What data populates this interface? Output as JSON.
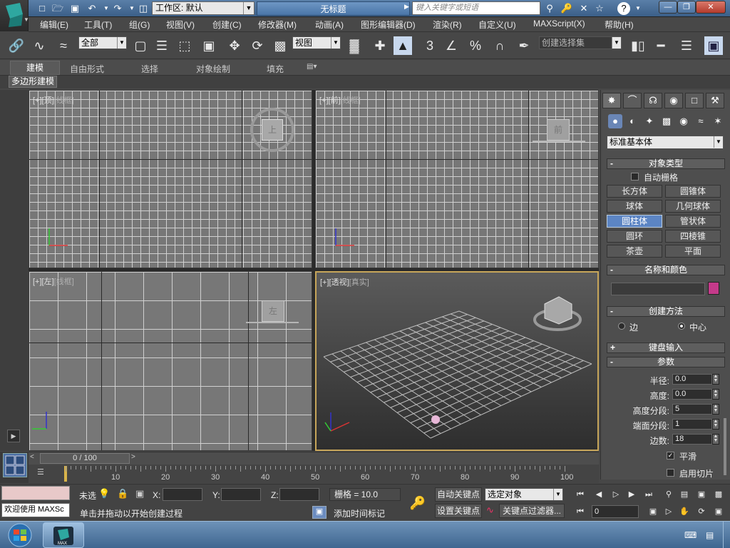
{
  "title_bar": {
    "workspace_label": "工作区: 默认",
    "document_title": "无标题",
    "search_placeholder": "键入关键字或短语"
  },
  "menu": [
    "编辑(E)",
    "工具(T)",
    "组(G)",
    "视图(V)",
    "创建(C)",
    "修改器(M)",
    "动画(A)",
    "图形编辑器(D)",
    "渲染(R)",
    "自定义(U)",
    "MAXScript(X)",
    "帮助(H)"
  ],
  "toolbar": {
    "filter_value": "全部",
    "coord_value": "视图",
    "snap_count": "3",
    "selection_set_placeholder": "创建选择集"
  },
  "ribbon": {
    "tabs": [
      "建模",
      "自由形式",
      "选择",
      "对象绘制",
      "填充"
    ],
    "sub_label": "多边形建模"
  },
  "viewports": {
    "top": {
      "plus": "[+]",
      "name": "[顶]",
      "mode": "[线框]",
      "cube_label": "上"
    },
    "front": {
      "plus": "[+]",
      "name": "[前]",
      "mode": "[线框]",
      "cube_label": "前"
    },
    "left": {
      "plus": "[+]",
      "name": "[左]",
      "mode": "[线框]",
      "cube_label": "左"
    },
    "persp": {
      "plus": "[+]",
      "name": "[透视]",
      "mode": "[真实]"
    }
  },
  "command_panel": {
    "category": "标准基本体",
    "object_type_title": "对象类型",
    "autogrid_label": "自动栅格",
    "object_buttons": [
      "长方体",
      "圆锥体",
      "球体",
      "几何球体",
      "圆柱体",
      "管状体",
      "圆环",
      "四棱锥",
      "茶壶",
      "平面"
    ],
    "active_object": "圆柱体",
    "name_color_title": "名称和颜色",
    "name_value": "",
    "swatch_color": "#c43a8a",
    "creation_method_title": "创建方法",
    "creation_edge": "边",
    "creation_center": "中心",
    "keyboard_entry_title": "键盘输入",
    "params_title": "参数",
    "params": [
      {
        "label": "半径:",
        "value": "0.0"
      },
      {
        "label": "高度:",
        "value": "0.0"
      },
      {
        "label": "高度分段:",
        "value": "5"
      },
      {
        "label": "端面分段:",
        "value": "1"
      },
      {
        "label": "边数:",
        "value": "18"
      }
    ],
    "smooth_label": "平滑",
    "slice_label": "启用切片"
  },
  "timeline": {
    "frame": "0 / 100",
    "ticks": [
      "10",
      "20",
      "30",
      "40",
      "50",
      "60",
      "70",
      "80",
      "90",
      "100"
    ]
  },
  "status": {
    "maxscript": "欢迎使用 MAXSc",
    "selection_state": "未选",
    "x_label": "X:",
    "y_label": "Y:",
    "z_label": "Z:",
    "grid": "栅格 = 10.0",
    "prompt": "单击并拖动以开始创建过程",
    "add_time_tag": "添加时间标记",
    "auto_key": "自动关键点",
    "set_key": "设置关键点",
    "key_mode_value": "选定对象",
    "key_filters": "关键点过滤器...",
    "current_frame": "0"
  },
  "icons": [
    "app-logo-icon",
    "new-icon",
    "open-icon",
    "save-icon",
    "undo-icon",
    "redo-icon",
    "binoculars-icon",
    "help-icon"
  ]
}
